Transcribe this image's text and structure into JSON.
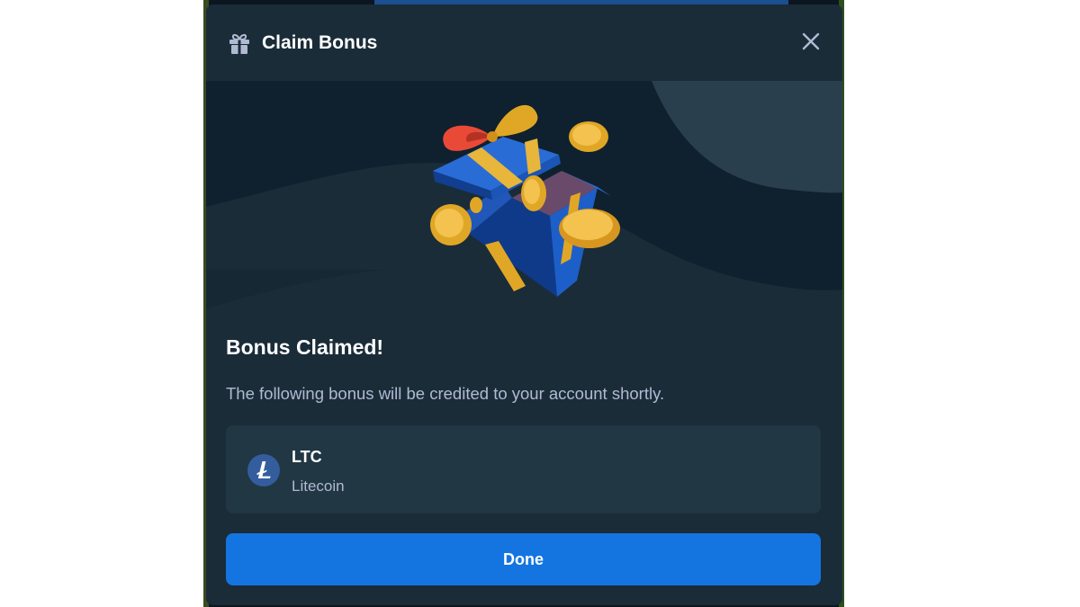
{
  "modal": {
    "title": "Claim Bonus",
    "header_icon": "gift-icon",
    "close_icon": "close-icon"
  },
  "content": {
    "heading": "Bonus Claimed!",
    "description": "The following bonus will be credited to your account shortly."
  },
  "coin": {
    "icon": "litecoin-icon",
    "symbol": "LTC",
    "name": "Litecoin"
  },
  "actions": {
    "done_label": "Done"
  },
  "colors": {
    "modal_bg": "#1a2c38",
    "hero_bg": "#0f212e",
    "card_bg": "#213743",
    "primary_button": "#1475e1",
    "muted_text": "#b1bad3",
    "litecoin": "#345d9d"
  }
}
